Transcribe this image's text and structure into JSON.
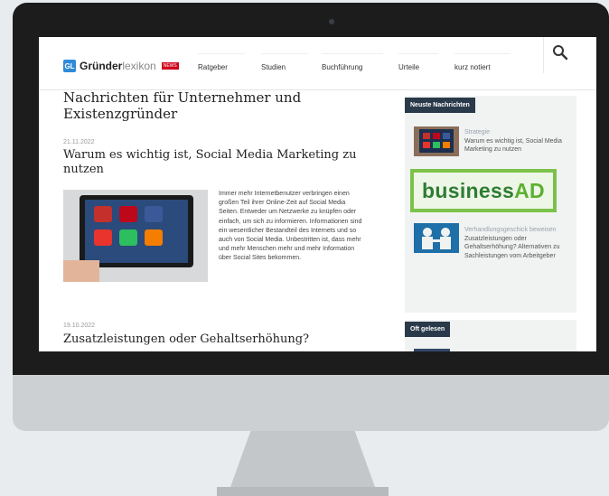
{
  "logo": {
    "part_a": "Gründer",
    "part_b": "lexikon",
    "badge": "NEWS",
    "mark": "GL"
  },
  "nav": {
    "items": [
      "Ratgeber",
      "Studien",
      "Buchführung",
      "Urteile",
      "kurz notiert"
    ]
  },
  "headline": "Nachrichten für Unternehmer und Existenzgründer",
  "articles": [
    {
      "date": "21.11.2022",
      "title": "Warum es wichtig ist, Social Media Marketing zu nutzen",
      "text": "Immer mehr Internetbenutzer verbringen einen großen Teil ihrer Online-Zeit auf Social Media Seiten. Entweder um Netzwerke zu knüpfen oder einfach, um sich zu informieren. Informationen sind ein wesentlicher Bestandteil des Internets und so auch von Social Media. Unbestritten ist, dass mehr und mehr Menschen mehr und mehr Information über Social Sites bekommen."
    },
    {
      "date": "19.10.2022",
      "title": "Zusatzleistungen oder Gehaltserhöhung?"
    }
  ],
  "sidebar": {
    "heading": "Neuste Nachrichten",
    "items": [
      {
        "category": "Strategie",
        "title": "Warum es wichtig ist, Social Media Marketing zu nutzen"
      },
      {
        "category": "Verhandlungsgeschick beweisen",
        "title": "Zusatzleistungen oder Gehaltserhöhung? Alternativen zu Sachleistungen vom Arbeitgeber"
      }
    ],
    "ad": {
      "part_a": "business",
      "part_b": "AD"
    },
    "heading2": "Oft gelesen"
  },
  "colors": {
    "accent": "#2a3a4a",
    "ad_green": "#7bc24a",
    "news_red": "#d0021b"
  }
}
